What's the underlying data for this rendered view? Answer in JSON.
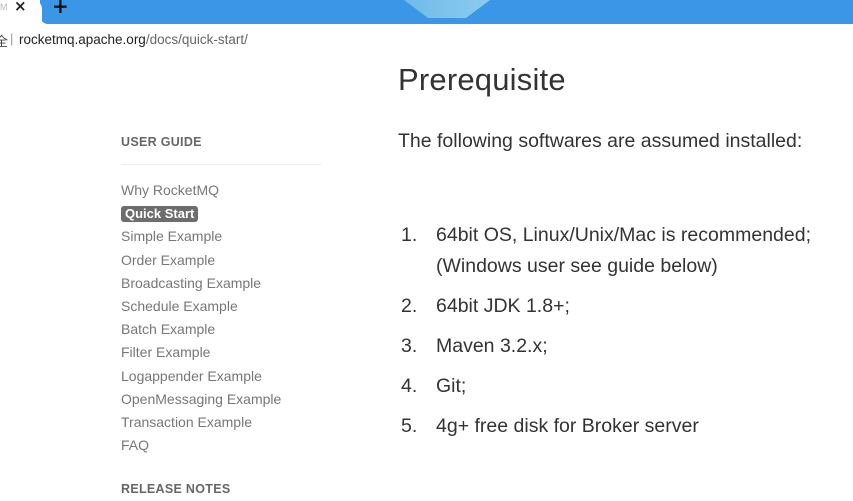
{
  "browser": {
    "tab_label": "M",
    "new_tab_label": "+",
    "secure_label": "全",
    "url_separator": "|",
    "url_host": "rocketmq.apache.org",
    "url_path": "/docs/quick-start/",
    "accent_color": "#3c96e8"
  },
  "sidebar": {
    "user_guide_title": "USER GUIDE",
    "items": [
      {
        "label": "Why RocketMQ"
      },
      {
        "label": "Quick Start",
        "active": true
      },
      {
        "label": "Simple Example"
      },
      {
        "label": "Order Example"
      },
      {
        "label": "Broadcasting Example"
      },
      {
        "label": "Schedule Example"
      },
      {
        "label": "Batch Example"
      },
      {
        "label": "Filter Example"
      },
      {
        "label": "Logappender Example"
      },
      {
        "label": "OpenMessaging Example"
      },
      {
        "label": "Transaction Example"
      },
      {
        "label": "FAQ"
      }
    ],
    "release_notes_title": "RELEASE NOTES"
  },
  "main": {
    "title": "Prerequisite",
    "intro": "The following softwares are assumed installed:",
    "requirements": [
      {
        "num": "1.",
        "text": "64bit OS, Linux/Unix/Mac is recommended;(Windows user see guide below)"
      },
      {
        "num": "2.",
        "text": "64bit JDK 1.8+;"
      },
      {
        "num": "3.",
        "text": "Maven 3.2.x;"
      },
      {
        "num": "4.",
        "text": "Git;"
      },
      {
        "num": "5.",
        "text": "4g+ free disk for Broker server"
      }
    ]
  }
}
